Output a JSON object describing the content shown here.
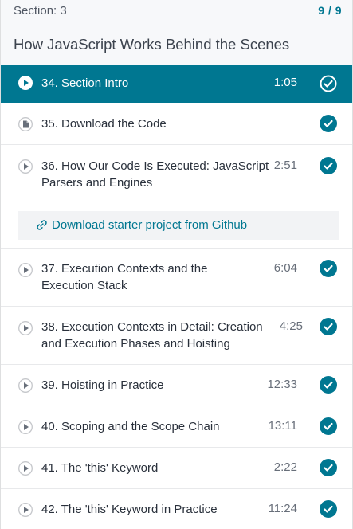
{
  "section": {
    "number_label": "Section: 3",
    "progress": "9 / 9",
    "title": "How JavaScript Works Behind the Scenes"
  },
  "lectures": [
    {
      "title": "34. Section Intro",
      "duration": "1:05",
      "type": "video",
      "active": true,
      "completed": true
    },
    {
      "title": "35. Download the Code",
      "duration": "",
      "type": "file",
      "active": false,
      "completed": true
    },
    {
      "title": "36. How Our Code Is Executed: JavaScript",
      "title2": "Parsers and Engines",
      "duration": "2:51",
      "type": "video",
      "active": false,
      "completed": true
    },
    {
      "title": "37. Execution Contexts and the",
      "title2": "Execution Stack",
      "duration": "6:04",
      "type": "video",
      "active": false,
      "completed": true
    },
    {
      "title": "38. Execution Contexts in Detail: Creation",
      "title2": "and Execution Phases and Hoisting",
      "duration": "4:25",
      "type": "video",
      "active": false,
      "completed": true
    },
    {
      "title": "39. Hoisting in Practice",
      "duration": "12:33",
      "type": "video",
      "active": false,
      "completed": true
    },
    {
      "title": "40. Scoping and the Scope Chain",
      "duration": "13:11",
      "type": "video",
      "active": false,
      "completed": true
    },
    {
      "title": "41. The 'this' Keyword",
      "duration": "2:22",
      "type": "video",
      "active": false,
      "completed": true
    },
    {
      "title": "42. The 'this' Keyword in Practice",
      "duration": "11:24",
      "type": "video",
      "active": false,
      "completed": true
    }
  ],
  "resource": {
    "label": "Download starter project from Github"
  },
  "colors": {
    "accent": "#007791",
    "check": "#007791",
    "text": "#29303b",
    "muted": "#686f7a"
  },
  "icons": {
    "video": "play-circle-icon",
    "file": "file-icon",
    "completed": "check-circle-icon",
    "link": "link-icon"
  }
}
